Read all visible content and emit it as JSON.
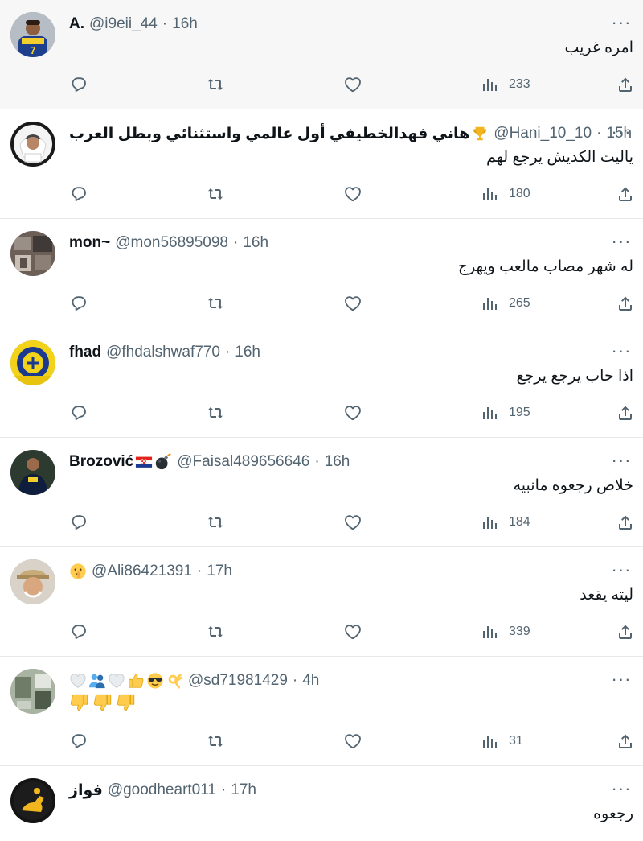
{
  "tweets": [
    {
      "name": "A.",
      "handle": "@i9eii_44",
      "time": "16h",
      "text": "امره غريب",
      "views": "233",
      "avatar": "avatar-player-yellow",
      "highlighted": true
    },
    {
      "name": "هاني فهدالخطيفي أول عالمي واستثنائي وبطل العرب",
      "name_emoji": "trophy-emoji",
      "handle": "@Hani_10_10",
      "time": "15h",
      "text": "ياليت الكديش يرجع لهم",
      "views": "180",
      "avatar": "avatar-man-ghutra"
    },
    {
      "name": "mon~",
      "handle": "@mon56895098",
      "time": "16h",
      "text": "له شهر مصاب مالعب ويهرج",
      "views": "265",
      "avatar": "avatar-photo-collage"
    },
    {
      "name": "fhad",
      "handle": "@fhdalshwaf770",
      "time": "16h",
      "text": "اذا حاب يرجع يرجع",
      "views": "195",
      "avatar": "avatar-nassr-logo"
    },
    {
      "name": "Brozović",
      "name_emoji": [
        "croatia-flag-emoji",
        "bomb-emoji"
      ],
      "handle": "@Faisal489656646",
      "time": "16h",
      "text": "خلاص رجعوه مانبيه",
      "views": "184",
      "avatar": "avatar-player-dark"
    },
    {
      "name": "",
      "name_emoji": "shushing-face-emoji",
      "handle": "@Ali86421391",
      "time": "17h",
      "text": "ليته يقعد",
      "views": "339",
      "avatar": "avatar-man-cap"
    },
    {
      "name": "",
      "name_emoji": [
        "white-heart-emoji",
        "people-emoji",
        "white-heart-emoji",
        "thumbs-up-emoji",
        "sunglasses-emoji",
        "ok-hand-emoji"
      ],
      "handle": "@sd71981429",
      "time": "4h",
      "text": "",
      "body_emoji": [
        "thumbs-down-emoji",
        "thumbs-down-emoji",
        "thumbs-down-emoji"
      ],
      "views": "31",
      "avatar": "avatar-room-photo"
    },
    {
      "name": "فواز",
      "handle": "@goodheart011",
      "time": "17h",
      "text": "رجعوه",
      "views": "",
      "avatar": "avatar-horse-rider"
    }
  ],
  "separator": "·",
  "more_glyph": "···",
  "colors": {
    "text": "#0f1419",
    "muted": "#536471",
    "divider": "#e6e9ec",
    "highlight": "#f7f7f7"
  }
}
